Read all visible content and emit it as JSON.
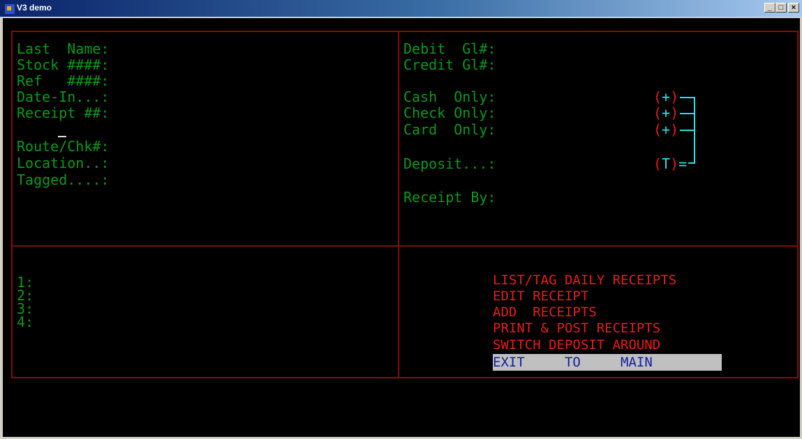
{
  "window": {
    "title": "V3 demo",
    "minimize": "_",
    "maximize": "□",
    "close": "×"
  },
  "left_fields": [
    "Last  Name:",
    "Stock ####:",
    "Ref   ####:",
    "Date-In...:",
    "Receipt ##:",
    "Route/Chk#:",
    "Location..:",
    "Tagged....:"
  ],
  "right_fields": {
    "debit": "Debit  Gl#:",
    "credit": "Credit Gl#:",
    "cash": "Cash  Only:",
    "check": "Check Only:",
    "card": "Card  Only:",
    "deposit": "Deposit...:",
    "receipt_by": "Receipt By:"
  },
  "markers": {
    "plus": "+",
    "total": "T",
    "open": "(",
    "close": ")",
    "equals": "="
  },
  "lines": [
    "1:",
    "2:",
    "3:",
    "4:"
  ],
  "menu": [
    "LIST/TAG DAILY RECEIPTS",
    "EDIT RECEIPT",
    "ADD  RECEIPTS",
    "PRINT & POST RECEIPTS",
    "SWITCH DEPOSIT AROUND",
    "EXIT     TO     MAIN"
  ],
  "colors": {
    "label": "#0a9a1a",
    "menu": "#ee1a1a",
    "marker": "#30e0e0",
    "border": "#8b0a0a",
    "selected_bg": "#c0c0c0",
    "selected_fg": "#1020a0"
  }
}
